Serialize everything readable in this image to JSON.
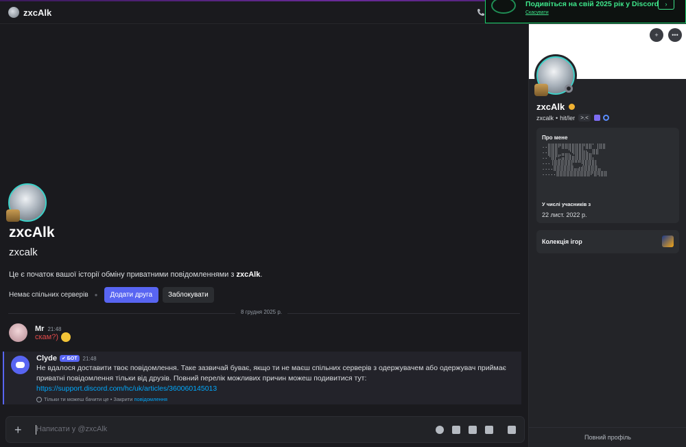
{
  "header": {
    "name": "zxcAlk"
  },
  "promo": {
    "title": "Подивіться на свій 2025 рік у Discord",
    "cancel": "Скасувати",
    "arrow": "›"
  },
  "intro": {
    "name": "zxcAlk",
    "username": "zxcalk",
    "text_before": "Це є початок вашої історії обміну приватними повідомленнями з ",
    "text_name": "zxcAlk",
    "text_after": ".",
    "no_servers": "Немає спільних серверів",
    "add_friend": "Додати друга",
    "block": "Заблокувати"
  },
  "date_divider": "8 грудня 2025 р.",
  "messages": [
    {
      "author": "Mr",
      "time": "21:48",
      "text": "скам?)"
    },
    {
      "author": "Clyde",
      "badge": "✔ БОТ",
      "time": "21:48",
      "text": "Не вдалося доставити твоє повідомлення. Таке зазвичай буває, якщо ти не маєш спільних серверів з одержувачем або одержувач приймає приватні повідомлення тільки від друзів. Повний перелік можливих причин можеш подивитися тут:",
      "link": "https://support.discord.com/hc/uk/articles/360060145013",
      "note_prefix": "Тільки ти можеш бачити це • Закрити ",
      "note_link": "повідомлення"
    }
  ],
  "composer": {
    "placeholder": "Написати у @zxcAlk"
  },
  "profile": {
    "name": "zxcAlk",
    "username": "zxcalk",
    "pronouns": "hit/ler",
    "tag": ">.<",
    "about_title": "Про мене",
    "about_ascii": "..⣿⣿⣿⠟⣿⣿⣿⣿⣿⣿⡟⣿⣿⠁⢸⣿⣿\n..⣿⣿⣿⠀⣀⣀⡙⢿⣿⣿⣷⣦⣀⣿⣿\n..⠙⣿⡟⣋⣭⣿⣿⣶⣿⣿⣿⣿⣿⡄⠀\n...⢸⣿⣿⣿⣿⣿⡟⠛⠛⢿⣿⣿⣿⡇⠀\n....⣿⣿⣿⣿⣿⣿⣤⣴⣾⣿⣿⣿⣿⣤\n.....⣿⣿⣿⣿⣿⣿⣿⣿⣿⣿⠟⣿⢿⣿⣿",
    "member_since_label": "У числі учасників з",
    "member_since": "22 лист. 2022 р.",
    "games_label": "Колекція ігор",
    "full_profile": "Повний профіль"
  },
  "colors": {
    "accent": "#5865f2",
    "link": "#00a8fc",
    "promo_green": "#3ee58a",
    "red_text": "#e24b4b"
  }
}
